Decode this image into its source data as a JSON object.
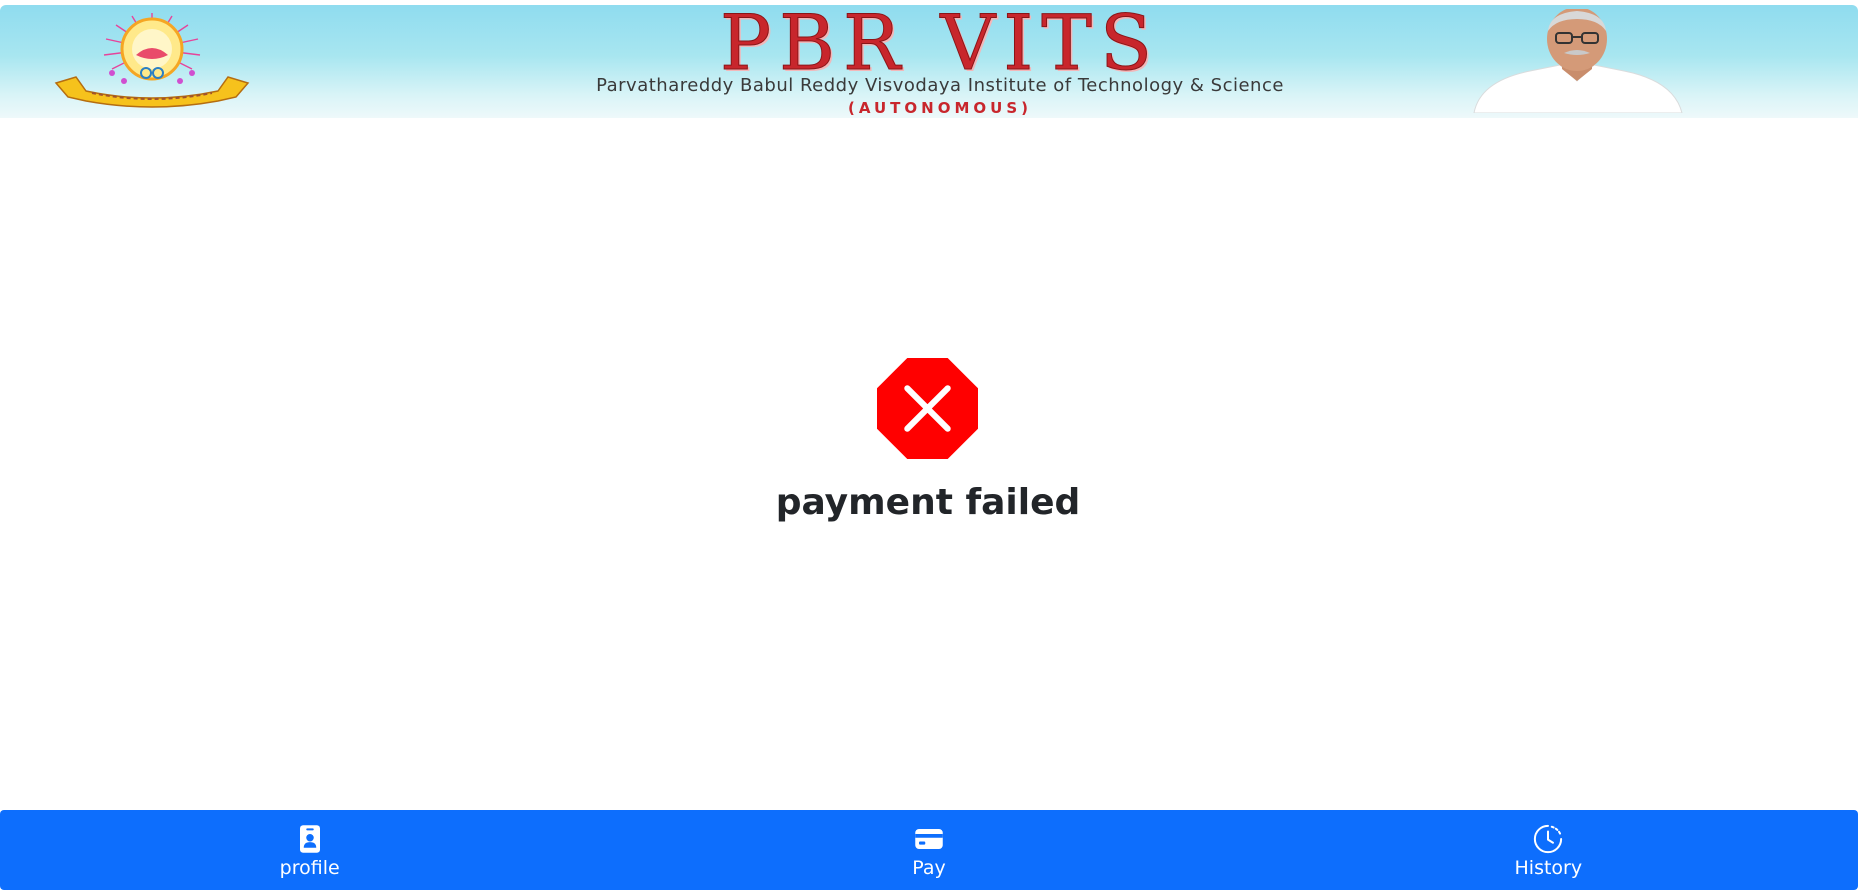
{
  "header": {
    "logo_icon": "institute-emblem-icon",
    "title": "PBR VITS",
    "subtitle": "Parvathareddy Babul Reddy Visvodaya Institute of Technology & Science",
    "autonomous": "(AUTONOMOUS)",
    "portrait_icon": "founder-portrait-icon"
  },
  "status": {
    "icon": "error-octagon-icon",
    "message": "payment failed",
    "icon_color": "#ff0000"
  },
  "nav": {
    "items": [
      {
        "label": "profile",
        "icon": "person-badge-icon"
      },
      {
        "label": "Pay",
        "icon": "credit-card-icon"
      },
      {
        "label": "History",
        "icon": "clock-history-icon"
      }
    ],
    "background": "#0d6efd"
  },
  "colors": {
    "brand_red": "#c8262c",
    "header_top": "#8fdcef",
    "text_dark": "#222529"
  }
}
